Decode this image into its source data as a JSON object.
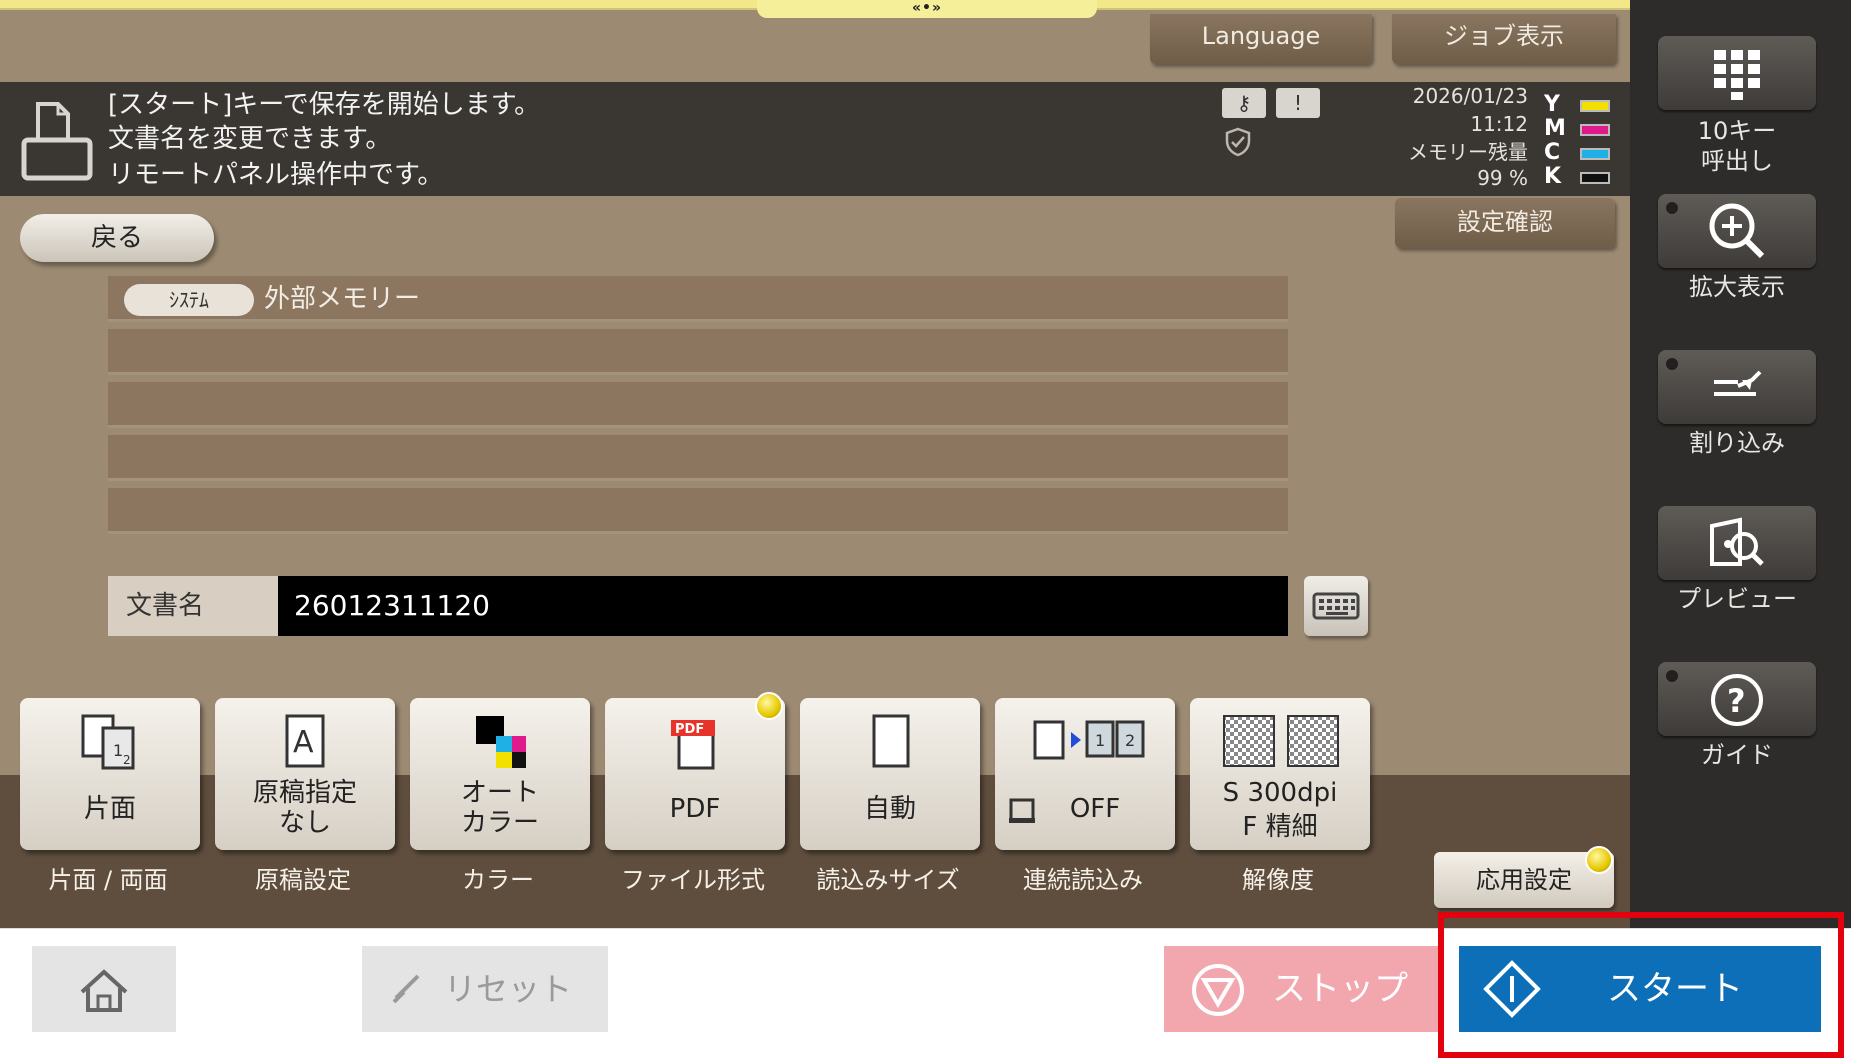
{
  "header": {
    "handle": "«•»",
    "language_button": "Language",
    "job_button": "ジョブ表示"
  },
  "status": {
    "messages": [
      "[スタート]キーで保存を開始します。",
      "文書名を変更できます。",
      "リモートパネル操作中です。"
    ],
    "date": "2026/01/23",
    "time": "11:12",
    "memory_label": "メモリー残量",
    "memory_value": "99 %",
    "toner": [
      {
        "letter": "Y",
        "color": "#f2e100"
      },
      {
        "letter": "M",
        "color": "#e01a8c"
      },
      {
        "letter": "C",
        "color": "#1fb0e6"
      },
      {
        "letter": "K",
        "color": "#111111"
      }
    ]
  },
  "nav": {
    "back": "戻る",
    "settings_confirm": "設定確認"
  },
  "folder": {
    "badge": "ｼｽﾃﾑ",
    "path": "外部メモリー"
  },
  "document_name": {
    "label": "文書名",
    "value": "26012311120"
  },
  "functions": [
    {
      "name": "duplex",
      "lines": [
        "片面"
      ],
      "caption": "片面 / 両面"
    },
    {
      "name": "original",
      "lines": [
        "原稿指定",
        "なし"
      ],
      "caption": "原稿設定"
    },
    {
      "name": "color",
      "lines": [
        "オート",
        "カラー"
      ],
      "caption": "カラー"
    },
    {
      "name": "file-format",
      "lines": [
        "PDF"
      ],
      "caption": "ファイル形式",
      "badge_text": "PDF"
    },
    {
      "name": "scan-size",
      "lines": [
        "自動"
      ],
      "caption": "読込みサイズ"
    },
    {
      "name": "continuous",
      "lines": [
        "OFF"
      ],
      "caption": "連続読込み"
    },
    {
      "name": "resolution",
      "lines": [
        "S 300dpi",
        "F 精細"
      ],
      "caption": "解像度"
    }
  ],
  "apply_settings": "応用設定",
  "side": {
    "tenkey": [
      "10キー",
      "呼出し"
    ],
    "zoom": "拡大表示",
    "interrupt": "割り込み",
    "preview": "プレビュー",
    "guide": "ガイド"
  },
  "footer": {
    "reset": "リセット",
    "stop": "ストップ",
    "start": "スタート"
  }
}
